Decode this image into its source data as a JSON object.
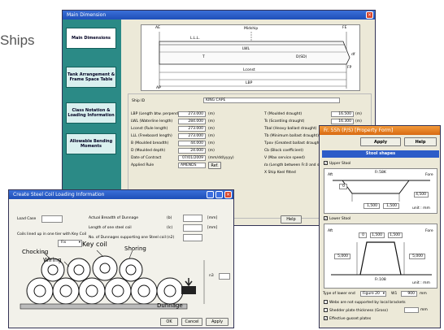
{
  "side_caption": "Ships",
  "main_window": {
    "title": "Main Dimension",
    "nav": [
      "Main Dimensions",
      "Tank Arrangement & Frame Space Table",
      "Class Notation & Loading Information",
      "Allowable Bending Moments"
    ],
    "diagram": {
      "ae": "AE",
      "fe": "FE",
      "midship": "Midship",
      "lll": "L.L.L.",
      "lwl": "LWL",
      "t": "T",
      "dsd": "D(SD)",
      "lconst": "Lconst",
      "lbp": "LBP",
      "ap": "AP",
      "fp": "FP",
      "df": "df"
    },
    "ship_id_label": "Ship ID",
    "ship_id_value": "KING CAPE",
    "left_fields": [
      {
        "label": "LBP (Length btw. perpendiculars)",
        "value": "273.000",
        "unit": "(m)"
      },
      {
        "label": "LWL (Waterline length)",
        "value": "284.000",
        "unit": "(m)"
      },
      {
        "label": "Lconst (Rule length)",
        "value": "273.000",
        "unit": "(m)"
      },
      {
        "label": "LLL (Freeboard length)",
        "value": "273.000",
        "unit": "(m)"
      },
      {
        "label": "B (Moulded breadth)",
        "value": "44.000",
        "unit": "(m)"
      },
      {
        "label": "D (Moulded depth)",
        "value": "24.000",
        "unit": "(m)"
      }
    ],
    "contract_label": "Date of Contract",
    "contract_value": "07/01/2009",
    "contract_format": "(mm/dd/yyyy)",
    "rule_label": "Applied Rule",
    "rule_value": "AMENDS",
    "rule_button": "Ref.",
    "right_fields": [
      {
        "label": "T (Moulded draught)",
        "value": "16.500",
        "unit": "(m)"
      },
      {
        "label": "Ts (Scantling draught)",
        "value": "16.300",
        "unit": "(m)"
      },
      {
        "label": "Tbal (Heavy ballast draught)",
        "value": "9.000",
        "unit": "(m)"
      },
      {
        "label": "Tb (Minimum ballast draught)",
        "value": "",
        "unit": ""
      },
      {
        "label": "Tpov (Greatest ballast draught)",
        "value": "",
        "unit": ""
      },
      {
        "label": "Cb (Block coefficient)",
        "value": "",
        "unit": ""
      },
      {
        "label": "V (Max service speed)",
        "value": "",
        "unit": ""
      },
      {
        "label": "ℓa (Length between Fr.0 and ship)",
        "value": "",
        "unit": ""
      }
    ],
    "keel_check": "X Ship Keel fitted",
    "help_button": "Help"
  },
  "coil_window": {
    "title": "Create Steel Coil Loading Information",
    "load_case_label": "Load Case",
    "breadth_label": "Actual Breadth of Dunnage",
    "breadth_unit_sym": "(b)",
    "breadth_unit": "[mm]",
    "length_label": "Length of one steel coil",
    "length_unit_sym": "(lc)",
    "length_unit": "[mm]",
    "dunnage_count_label": "No. of Dunnages supporting one Steel coil",
    "dunnage_count_sym": "(n2)",
    "keycoil_label": "Coils lined up in one tier with Key Coil",
    "select_value": "Fix",
    "annotations": {
      "chocking": "Chocking",
      "wiring": "Wiring",
      "key_coil": "Key coil",
      "shoring": "Shoring",
      "dunnage": "Dunnage",
      "n3": "n3"
    },
    "buttons": [
      "OK",
      "Cancel",
      "Apply"
    ]
  },
  "stool_window": {
    "title": "Fr. 55h (P/S) [Property Form]",
    "apply_button": "Apply",
    "help_button": "Help",
    "section_title": "Stool shapes",
    "upper_stool": {
      "check_label": "Upper Stool",
      "aft_label": "Aft",
      "fore_label": "Fore",
      "frame_label": "Fr.58K",
      "dims": [
        "0",
        "4,500",
        "1,500",
        "1,500"
      ],
      "unit": "unit : mm"
    },
    "lower_stool": {
      "check_label": "Lower Stool",
      "aft_label": "Aft",
      "fore_label": "Fore",
      "dims": [
        "0",
        "1,500",
        "1,500",
        "5,000",
        "5,000"
      ],
      "frame_label": "Fr.108",
      "unit": "unit : mm"
    },
    "type_label": "Type of lower end",
    "type_value": "Figure 20",
    "width_label": "W1",
    "width_value": "900",
    "width_unit": "mm",
    "options": [
      {
        "label": "Webs are not supported by local brackets",
        "checked": false
      },
      {
        "label": "Shedder plate thickness (Gross)",
        "checked": false
      },
      {
        "label": "Effective gusset plates",
        "checked": true
      }
    ],
    "shedder_unit": "mm"
  }
}
